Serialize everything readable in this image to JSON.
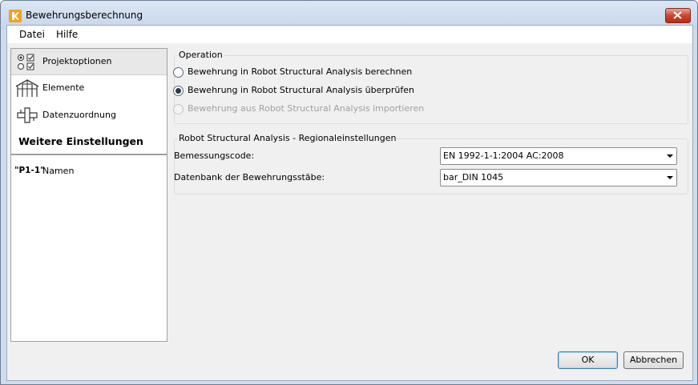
{
  "window": {
    "title": "Bewehrungsberechnung"
  },
  "menu": {
    "items": [
      "Datei",
      "Hilfe"
    ]
  },
  "sidebar": {
    "items": [
      {
        "label": "Projektoptionen",
        "icon": "options-icon",
        "selected": true
      },
      {
        "label": "Elemente",
        "icon": "structure-elements-icon"
      },
      {
        "label": "Datenzuordnung",
        "icon": "data-mapping-icon"
      }
    ],
    "heading": "Weitere Einstellungen",
    "names": {
      "icon_text": "\"P1-1\"",
      "label": "Namen"
    }
  },
  "operation": {
    "title": "Operation",
    "options": [
      {
        "label": "Bewehrung in Robot Structural Analysis berechnen",
        "checked": false,
        "disabled": false
      },
      {
        "label": "Bewehrung in Robot Structural Analysis überprüfen",
        "checked": true,
        "disabled": false
      },
      {
        "label": "Bewehrung aus Robot Structural Analysis importieren",
        "checked": false,
        "disabled": true
      }
    ]
  },
  "regional": {
    "title": "Robot Structural Analysis - Regionaleinstellungen",
    "design_code_label": "Bemessungscode:",
    "design_code_value": "EN 1992-1-1:2004 AC:2008",
    "bar_db_label": "Datenbank der Bewehrungsstäbe:",
    "bar_db_value": "bar_DIN 1045"
  },
  "buttons": {
    "ok": "OK",
    "cancel": "Abbrechen"
  }
}
